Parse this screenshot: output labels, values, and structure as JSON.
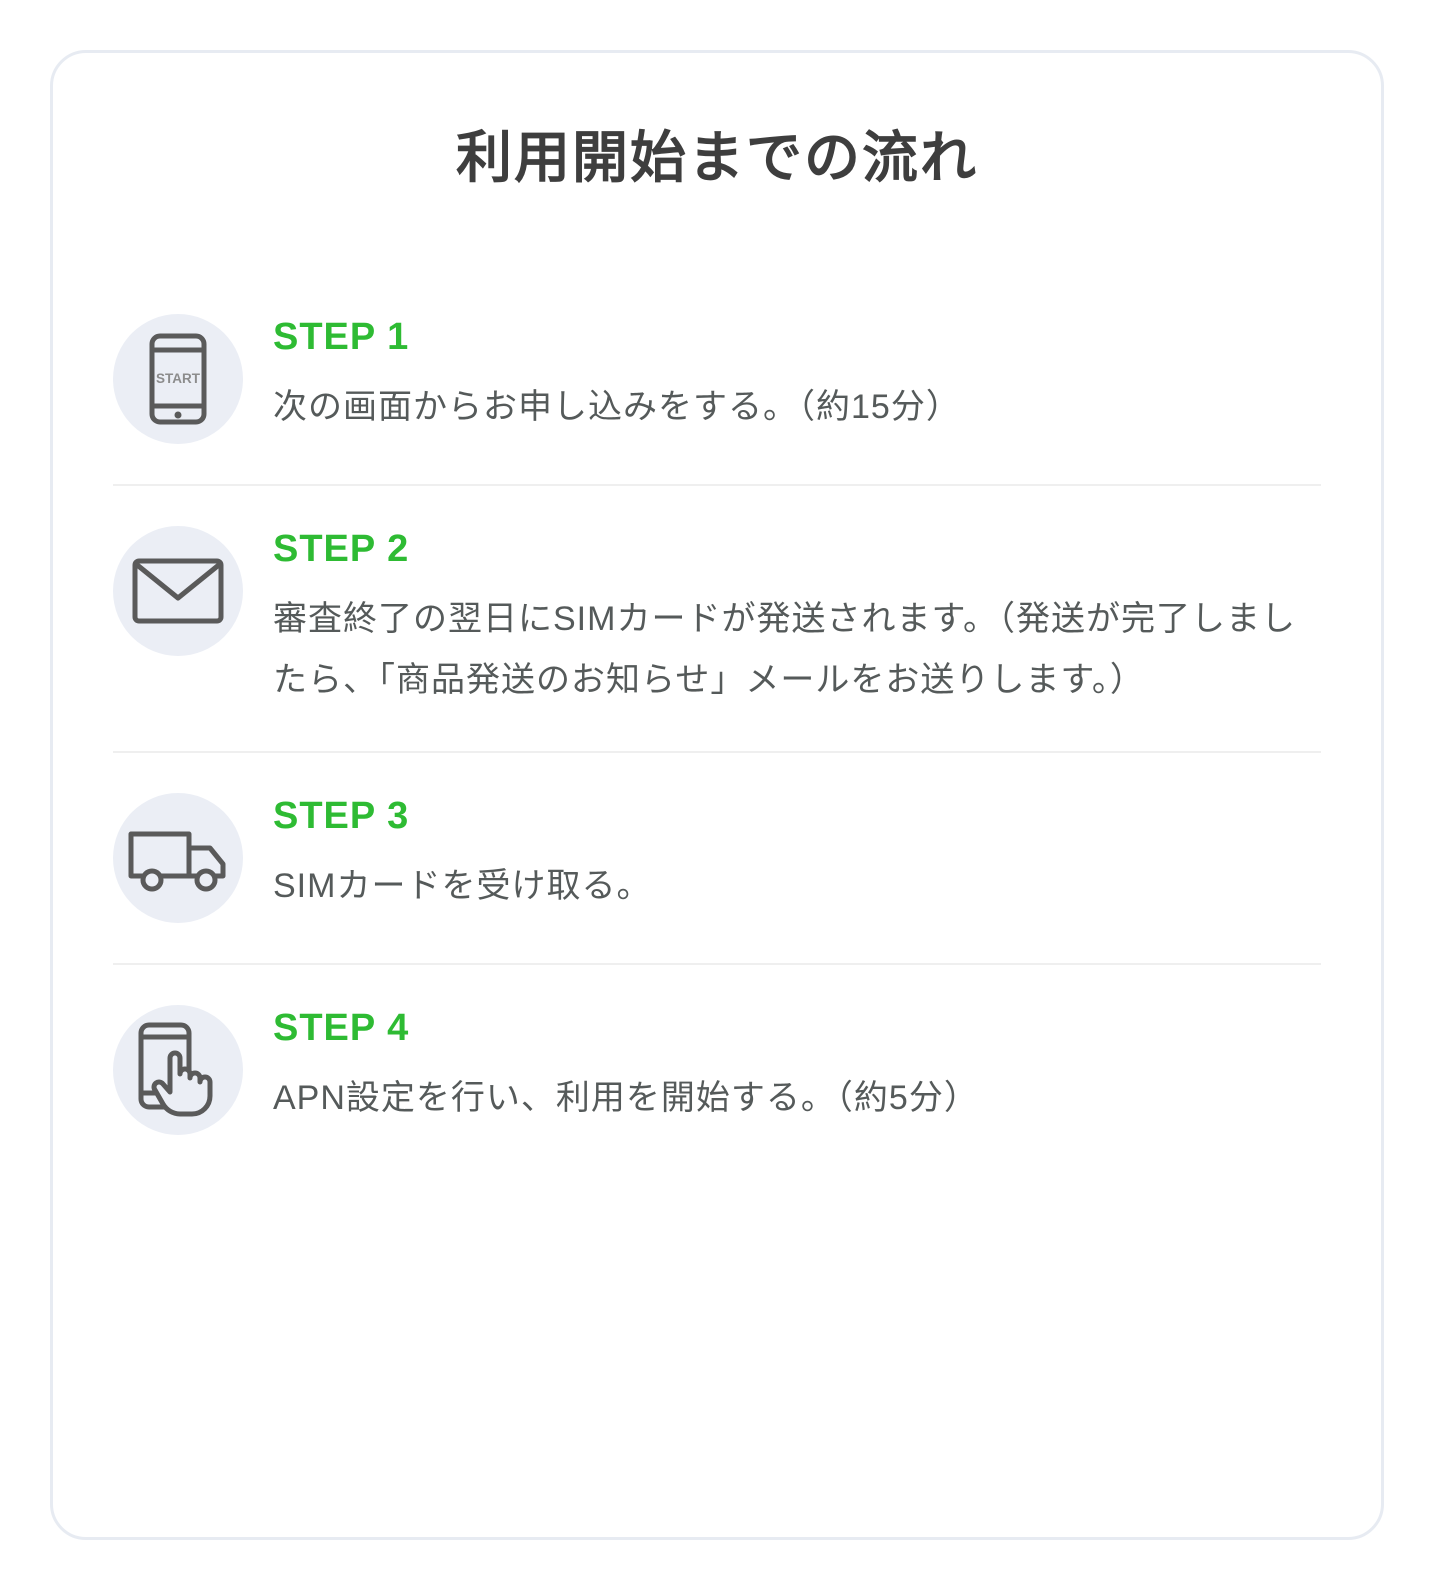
{
  "title": "利用開始までの流れ",
  "steps": [
    {
      "label": "STEP 1",
      "desc": "次の画面からお申し込みをする。（約15分）"
    },
    {
      "label": "STEP 2",
      "desc": "審査終了の翌日にSIMカードが発送されます。（発送が完了しましたら、「商品発送のお知らせ」メールをお送りします。）"
    },
    {
      "label": "STEP 3",
      "desc": "SIMカードを受け取る。"
    },
    {
      "label": "STEP 4",
      "desc": "APN設定を行い、利用を開始する。（約5分）"
    }
  ]
}
